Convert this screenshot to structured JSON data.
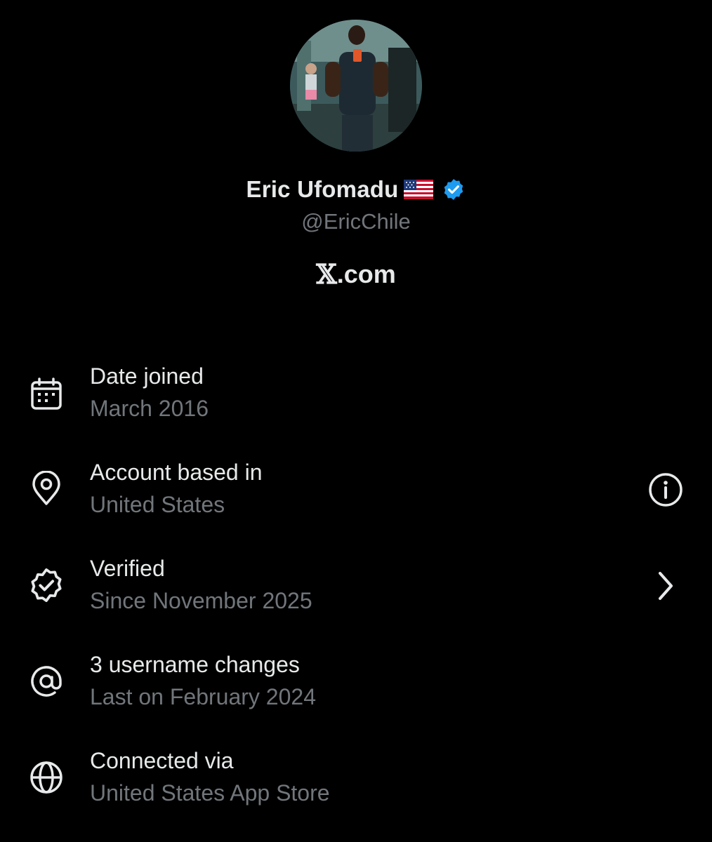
{
  "profile": {
    "display_name": "Eric Ufomadu",
    "flag": "🇺🇸",
    "verified_badge_color": "#1d9bf0",
    "handle": "@EricChile"
  },
  "brand": {
    "logo_glyph": "𝕏",
    "text": ".com"
  },
  "rows": [
    {
      "icon": "calendar-icon",
      "label": "Date joined",
      "value": "March 2016"
    },
    {
      "icon": "location-pin-icon",
      "label": "Account based in",
      "value": "United States",
      "action_icon": "info-icon"
    },
    {
      "icon": "verified-badge-outline-icon",
      "label": "Verified",
      "value": "Since November 2025",
      "action_icon": "chevron-right-icon"
    },
    {
      "icon": "at-sign-icon",
      "label": "3 username changes",
      "value": "Last on February 2024"
    },
    {
      "icon": "globe-icon",
      "label": "Connected via",
      "value": "United States App Store"
    }
  ],
  "colors": {
    "background": "#000000",
    "primary_text": "#e7e9ea",
    "secondary_text": "#71767b"
  }
}
